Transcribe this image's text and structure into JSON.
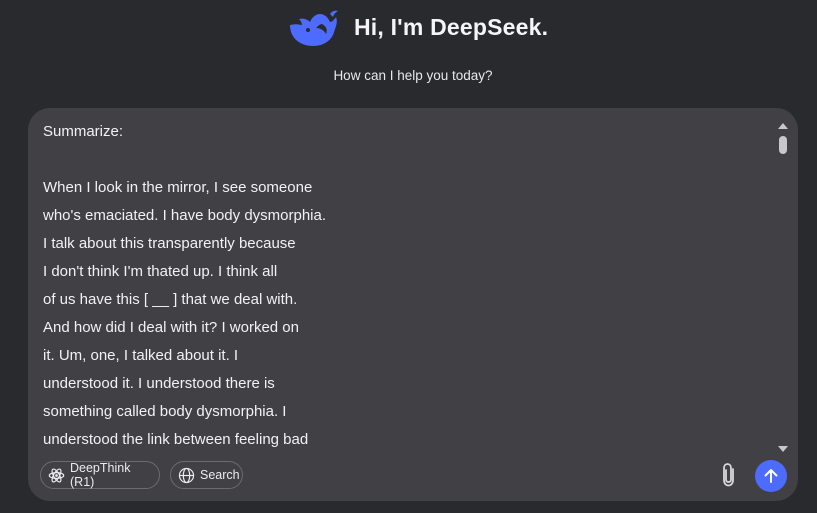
{
  "header": {
    "logo_icon": "deepseek-whale-icon",
    "title": "Hi, I'm DeepSeek.",
    "subtitle": "How can I help you today?",
    "accent_color": "#4d6bfe"
  },
  "composer": {
    "lines": [
      "Summarize:",
      "",
      "When I look in the mirror, I see someone",
      "who's emaciated. I have body dysmorphia.",
      "I talk about this transparently because",
      "I don't think I'm thated up. I think all",
      "of us have this [ __ ] that we deal with.",
      "And how did I deal with it? I worked on",
      "it. Um, one, I talked about it. I",
      "understood it. I understood there is",
      "something called body dysmorphia. I",
      "understood the link between feeling bad"
    ],
    "deepthink_label": "DeepThink (R1)",
    "deepthink_icon": "atom-icon",
    "search_label": "Search",
    "search_icon": "globe-icon",
    "attach_icon": "paperclip-icon",
    "send_icon": "arrow-up-icon"
  }
}
